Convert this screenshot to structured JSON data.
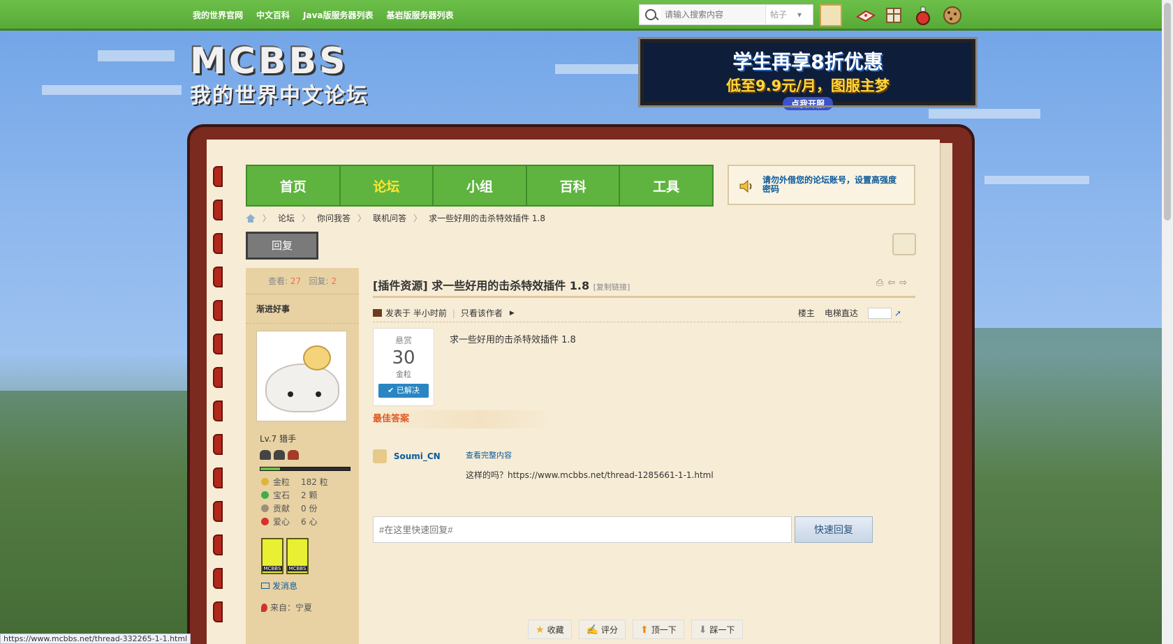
{
  "topbar": {
    "links": [
      "我的世界官网",
      "中文百科",
      "Java版服务器列表",
      "基岩版服务器列表"
    ],
    "search_placeholder": "请输入搜索内容",
    "search_type": "帖子"
  },
  "header": {
    "logo_line1": "MCBBS",
    "logo_line2": "我的世界中文论坛",
    "banner_line1": "学生再享8折优惠",
    "banner_line2": "低至9.9元/月，图服主梦",
    "banner_cta": "点我开服"
  },
  "nav": {
    "items": [
      "首页",
      "论坛",
      "小组",
      "百科",
      "工具"
    ],
    "active": "论坛",
    "notice": "请勿外借您的论坛账号，设置高强度密码"
  },
  "breadcrumb": [
    "论坛",
    "你问我答",
    "联机问答",
    "求一些好用的击杀特效插件 1.8"
  ],
  "reply_button": "回复",
  "sidebar": {
    "views_label": "查看:",
    "views": "27",
    "replies_label": "回复:",
    "replies": "2",
    "username": "渐进好事",
    "level": "Lv.7 猎手",
    "level_progress": 0.22,
    "credits": [
      {
        "label": "金粒",
        "value": "182 粒",
        "color": "#e0b43a"
      },
      {
        "label": "宝石",
        "value": "2 颗",
        "color": "#3fae4a"
      },
      {
        "label": "贡献",
        "value": "0 份",
        "color": "#9c8f7a"
      },
      {
        "label": "爱心",
        "value": "6 心",
        "color": "#d8302a"
      }
    ],
    "send_message": "发消息",
    "location": "来自：宁夏"
  },
  "post": {
    "title": "[插件资源] 求一些好用的击杀特效插件 1.8",
    "copy_link": "[复制链接]",
    "posted": "发表于 半小时前",
    "only_author": "只看该作者",
    "floor": "楼主",
    "jump": "电梯直达",
    "reward_label": "悬赏",
    "reward_amount": "30",
    "reward_unit": "金粒",
    "solved": "已解决",
    "content": "求一些好用的击杀特效插件 1.8",
    "best_answer_label": "最佳答案",
    "best_answer_user": "Soumi_CN",
    "view_full": "查看完整内容",
    "best_answer_text": "这样的吗？https://www.mcbbs.net/thread-1285661-1-1.html"
  },
  "quick_reply": {
    "placeholder": "#在这里快速回复#",
    "button": "快速回复"
  },
  "actions": [
    "收藏",
    "评分",
    "顶一下",
    "踩一下"
  ],
  "status_url": "https://www.mcbbs.net/thread-332265-1-1.html"
}
